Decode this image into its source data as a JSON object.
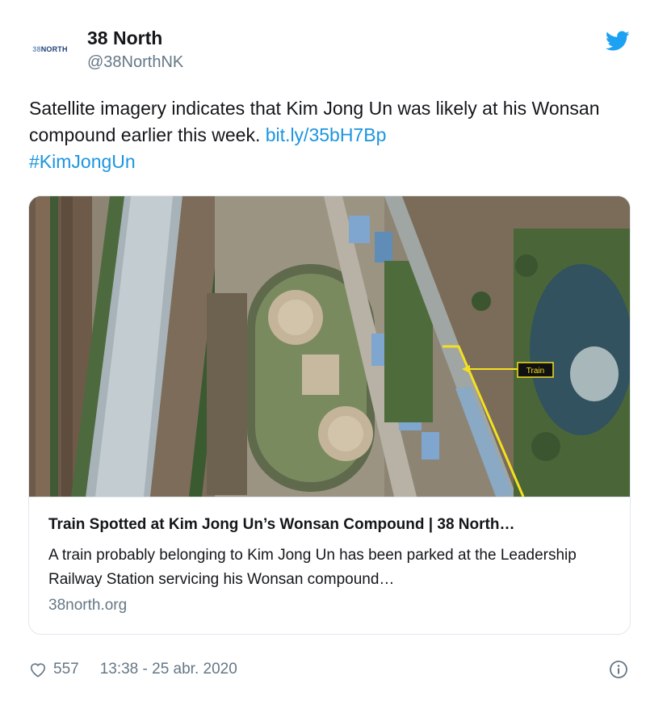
{
  "author": {
    "name": "38 North",
    "handle": "@38NorthNK",
    "avatar_logo_num": "38",
    "avatar_logo_word": "NORTH"
  },
  "tweet": {
    "text": "Satellite imagery indicates that Kim Jong Un was likely at his Wonsan compound earlier this week.",
    "link": "bit.ly/35bH7Bp",
    "hashtag": "#KimJongUn"
  },
  "card": {
    "image_label": "Train",
    "title": "Train Spotted at Kim Jong Un’s Wonsan Compound | 38 North…",
    "description": "A train probably belonging to Kim Jong Un has been parked at the Leadership Railway Station servicing his Wonsan compound…",
    "domain": "38north.org"
  },
  "footer": {
    "likes": "557",
    "timestamp": "13:38 - 25 abr. 2020"
  },
  "icons": {
    "brand": "twitter-bird-icon",
    "like": "heart-icon",
    "info": "info-icon"
  },
  "colors": {
    "twitter_blue": "#1da1f2",
    "link": "#1b95e0",
    "secondary_text": "#657786",
    "annotation_yellow": "#f5e020"
  }
}
